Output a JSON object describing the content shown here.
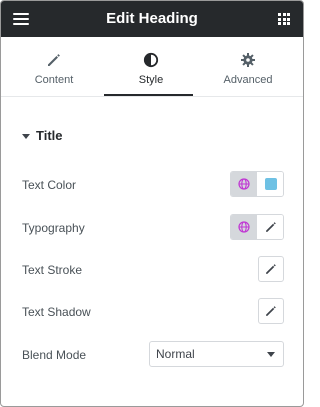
{
  "header": {
    "title": "Edit Heading",
    "menu_icon": "hamburger-menu-icon",
    "apps_icon": "grid-apps-icon",
    "background": "#26292c"
  },
  "tabs": [
    {
      "label": "Content",
      "icon": "pencil-icon",
      "active": false
    },
    {
      "label": "Style",
      "icon": "half-circle-contrast-icon",
      "active": true
    },
    {
      "label": "Advanced",
      "icon": "gear-icon",
      "active": false
    }
  ],
  "section": {
    "title": "Title",
    "expanded": true,
    "caret_icon": "caret-down-icon"
  },
  "rows": {
    "text_color": {
      "label": "Text Color",
      "global_icon": "globe-icon",
      "swatch_color": "#6ec1e4"
    },
    "typography": {
      "label": "Typography",
      "global_icon": "globe-icon",
      "edit_icon": "pencil-icon"
    },
    "text_stroke": {
      "label": "Text Stroke",
      "edit_icon": "pencil-icon"
    },
    "text_shadow": {
      "label": "Text Shadow",
      "edit_icon": "pencil-icon"
    },
    "blend_mode": {
      "label": "Blend Mode",
      "selected": "Normal",
      "dropdown_icon": "caret-down-icon"
    }
  },
  "colors": {
    "accent_global": "#c036d3",
    "swatch": "#6ec1e4",
    "tab_underline": "#26292c"
  }
}
